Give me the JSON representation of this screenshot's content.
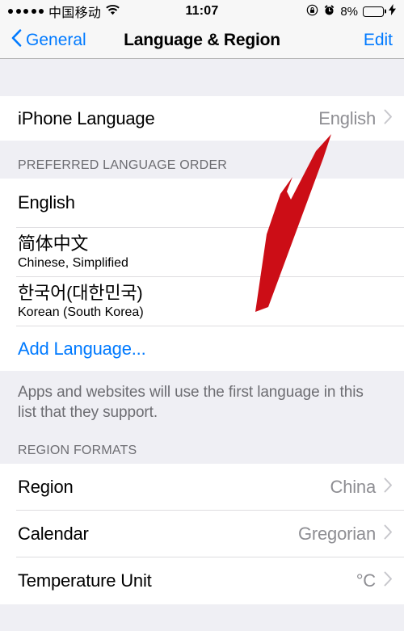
{
  "status_bar": {
    "signal_dots": 5,
    "carrier": "中国移动",
    "wifi_icon": "wifi-icon",
    "time": "11:07",
    "rotation_lock_icon": "rotation-lock-icon",
    "alarm_icon": "alarm-clock-icon",
    "battery_percent": "8%",
    "battery_fill_color": "#ffcc00",
    "charging_icon": "lightning-bolt-icon"
  },
  "nav_bar": {
    "back_label": "General",
    "back_icon": "chevron-left-icon",
    "title": "Language & Region",
    "edit_label": "Edit"
  },
  "iphone_language": {
    "title": "iPhone Language",
    "value": "English",
    "chevron": "chevron-right-icon"
  },
  "preferred_languages": {
    "header": "PREFERRED LANGUAGE ORDER",
    "items": [
      {
        "primary": "English",
        "secondary": ""
      },
      {
        "primary": "简体中文",
        "secondary": "Chinese, Simplified"
      },
      {
        "primary": "한국어(대한민국)",
        "secondary": "Korean (South Korea)"
      }
    ],
    "add_language_label": "Add Language...",
    "footer": "Apps and websites will use the first language in this list that they support."
  },
  "region_formats": {
    "header": "REGION FORMATS",
    "rows": [
      {
        "title": "Region",
        "value": "China"
      },
      {
        "title": "Calendar",
        "value": "Gregorian"
      },
      {
        "title": "Temperature Unit",
        "value": "°C"
      }
    ]
  },
  "annotation": {
    "arrow_color": "#cc0d16",
    "arrow_name": "red-annotation-arrow",
    "points_to": "English"
  },
  "colors": {
    "accent_blue": "#007aff",
    "group_background": "#efeff4",
    "row_background": "#ffffff",
    "secondary_text": "#8e8e93",
    "header_text": "#6d6d72"
  }
}
